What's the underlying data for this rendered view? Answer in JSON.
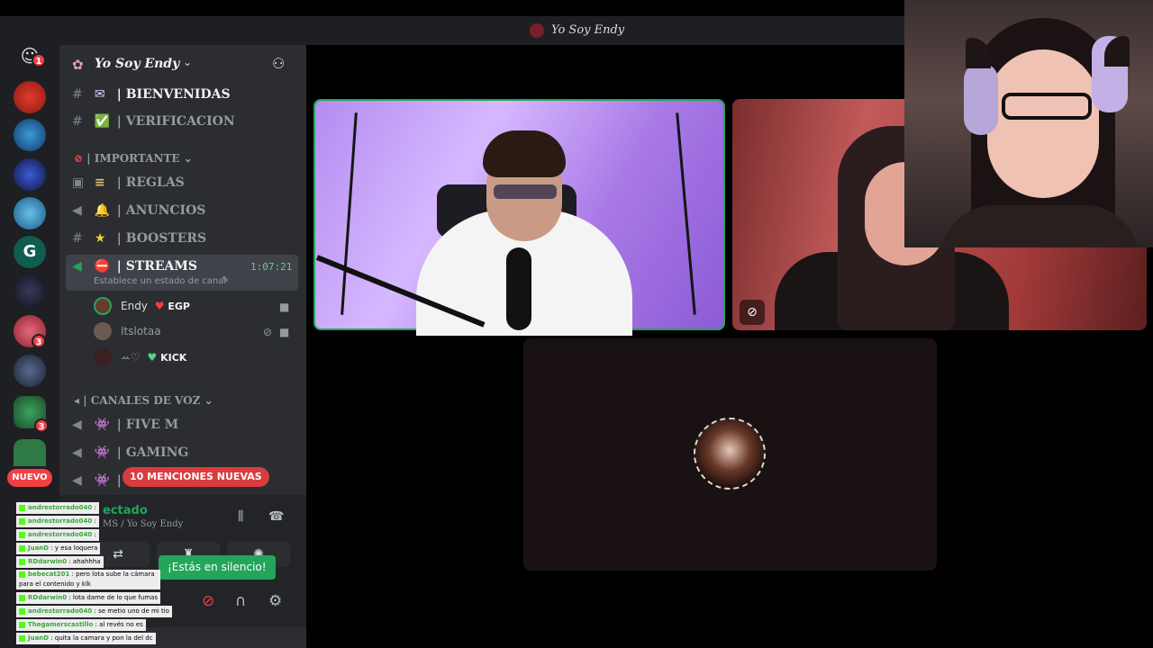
{
  "window": {
    "title": "Yo Soy Endy"
  },
  "server_rail": {
    "home_badge": "1",
    "badges": [
      "3",
      "3"
    ],
    "new_pill": "NUEVO"
  },
  "server": {
    "name": "Yo Soy Endy"
  },
  "channels": {
    "welcome": {
      "prefix": "|",
      "name": "BIENVENIDAS"
    },
    "verify": {
      "prefix": "|",
      "name": "VERIFICACION"
    },
    "category_important": "| IMPORTANTE",
    "rules": "| REGLAS",
    "announcements": "| ANUNCIOS",
    "boosters": "| BOOSTERS",
    "streams": "| STREAMS",
    "streams_timer": "1:07:21",
    "streams_status": "Establece un estado de canal",
    "category_voice": "| CANALES DE VOZ",
    "fivem": "| FIVE M",
    "gaming": "| GAMING",
    "partial": "|"
  },
  "voice_users": [
    {
      "name": "Endy",
      "tag": "EGP"
    },
    {
      "name": "Itslotaa"
    },
    {
      "name": "ꕀ♡",
      "tag": "KICK"
    }
  ],
  "mentions_pill": "10 MENCIONES NUEVAS",
  "voice_panel": {
    "status": "ectado",
    "sub": "MS / Yo Soy Endy"
  },
  "tooltip": "¡Estás en silencio!",
  "chat_overlay": [
    {
      "user": "andrestorrado040",
      "text": ":"
    },
    {
      "user": "andrestorrado040",
      "text": ":"
    },
    {
      "user": "andrestorrado040",
      "text": ":"
    },
    {
      "user": "JuanD",
      "text": ": y esa loquera"
    },
    {
      "user": "RDdarwin0",
      "text": ": ahahhha"
    },
    {
      "user": "bebecat201",
      "text": ": pero lota sube la cámara para el contenido y klk"
    },
    {
      "user": "RDdarwin0",
      "text": ": lota dame de lo que fumas"
    },
    {
      "user": "andrestorrado040",
      "text": ": se metio uno de mi tio"
    },
    {
      "user": "Thegamerscastillo",
      "text": ": al revés no es"
    },
    {
      "user": "JuanD",
      "text": ": quita la camara y pon la del dc"
    }
  ],
  "colors": {
    "accent_green": "#23a55a",
    "danger_red": "#f23f43",
    "sidebar_bg": "#2b2d31"
  }
}
